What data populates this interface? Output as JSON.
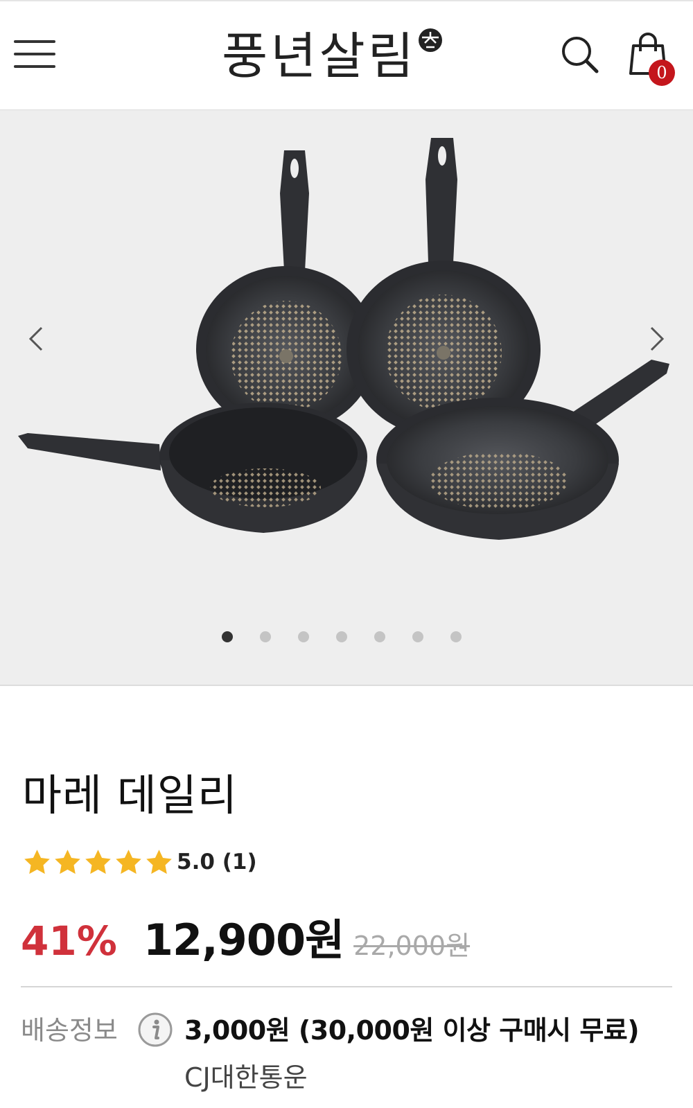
{
  "header": {
    "brand_logo": "풍년살림",
    "cart_count": "0"
  },
  "gallery": {
    "image_count": 7,
    "active_index": 0
  },
  "product": {
    "title": "마레 데일리",
    "rating": {
      "stars": 5,
      "text": "5.0 (1)"
    },
    "discount": "41%",
    "price": "12,900원",
    "original_price": "22,000원"
  },
  "shipping": {
    "label": "배송정보",
    "fee": "3,000원 (30,000원 이상 구매시 무료)",
    "courier": "CJ대한통운"
  },
  "colors": {
    "discount": "#d0313b",
    "badge": "#c4161c",
    "star": "#f5b623"
  }
}
